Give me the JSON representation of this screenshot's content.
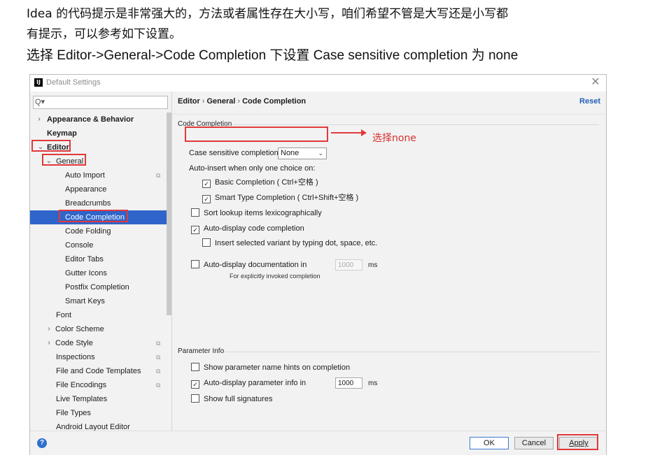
{
  "intro": {
    "line1": "Idea 的代码提示是非常强大的，方法或者属性存在大小写，咱们希望不管是大写还是小写都",
    "line2": "有提示，可以参考如下设置。",
    "line3": "选择 Editor->General->Code Completion 下设置 Case sensitive completion 为 none"
  },
  "dialog": {
    "title": "Default Settings",
    "app_icon": "IJ",
    "close_glyph": "✕"
  },
  "search": {
    "icon": "Q▾",
    "value": ""
  },
  "tree": [
    {
      "label": "Appearance & Behavior",
      "arrow": "›",
      "bold": true
    },
    {
      "label": "Keymap",
      "bold": true
    },
    {
      "label": "Editor",
      "arrow": "⌄",
      "bold": true
    },
    {
      "label": "General",
      "arrow": "⌄"
    },
    {
      "label": "Auto Import",
      "copy": true
    },
    {
      "label": "Appearance"
    },
    {
      "label": "Breadcrumbs"
    },
    {
      "label": "Code Completion",
      "selected": true
    },
    {
      "label": "Code Folding"
    },
    {
      "label": "Console"
    },
    {
      "label": "Editor Tabs"
    },
    {
      "label": "Gutter Icons"
    },
    {
      "label": "Postfix Completion"
    },
    {
      "label": "Smart Keys"
    },
    {
      "label": "Font"
    },
    {
      "label": "Color Scheme",
      "arrow": "›"
    },
    {
      "label": "Code Style",
      "arrow": "›",
      "copy": true
    },
    {
      "label": "Inspections",
      "copy": true
    },
    {
      "label": "File and Code Templates",
      "copy": true
    },
    {
      "label": "File Encodings",
      "copy": true
    },
    {
      "label": "Live Templates"
    },
    {
      "label": "File Types"
    },
    {
      "label": "Android Layout Editor"
    }
  ],
  "breadcrumb": {
    "a": "Editor",
    "b": "General",
    "c": "Code Completion",
    "sep": "›"
  },
  "reset_label": "Reset",
  "code_completion": {
    "section": "Code Completion",
    "case_label": "Case sensitive completion:",
    "case_value": "None",
    "autoinsert_label": "Auto-insert when only one choice on:",
    "basic": "Basic Completion ( Ctrl+空格 )",
    "smart": "Smart Type Completion ( Ctrl+Shift+空格 )",
    "sort": "Sort lookup items lexicographically",
    "autodisplay": "Auto-display code completion",
    "insert_variant": "Insert selected variant by typing dot, space, etc.",
    "autodoc": "Auto-display documentation in",
    "autodoc_ms": "1000",
    "ms": "ms",
    "autodoc_note": "For explicitly invoked completion",
    "check_glyph": "✓"
  },
  "param_info": {
    "section": "Parameter Info",
    "hints": "Show parameter name hints on completion",
    "autodisplay": "Auto-display parameter info in",
    "autodisplay_ms": "1000",
    "full_sig": "Show full signatures"
  },
  "annotation": {
    "text": "选择none"
  },
  "buttons": {
    "help": "?",
    "ok": "OK",
    "cancel": "Cancel",
    "apply": "Apply"
  },
  "colors": {
    "accent": "#2f65ca",
    "highlight_red": "#e0393b",
    "link": "#2260b8"
  }
}
